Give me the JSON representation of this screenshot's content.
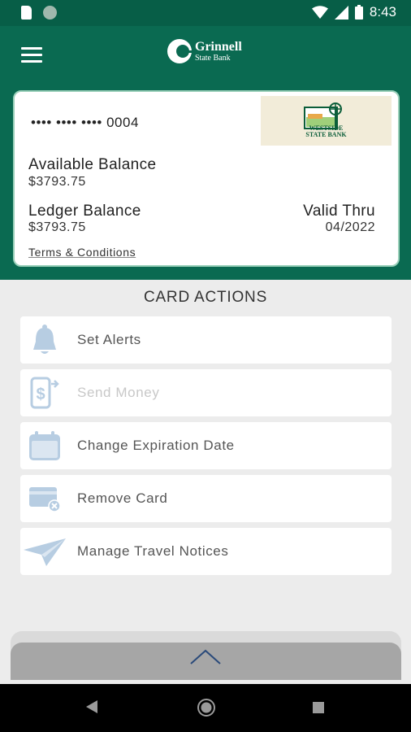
{
  "status_bar": {
    "time": "8:43"
  },
  "app_bar": {
    "logo_name": "Grinnell",
    "logo_sub": "State Bank"
  },
  "card": {
    "number": "•••• •••• •••• 0004",
    "bank_logo_text": "WESTSIDE STATE BANK",
    "available_label": "Available Balance",
    "available_value": "$3793.75",
    "ledger_label": "Ledger Balance",
    "ledger_value": "$3793.75",
    "valid_label": "Valid Thru",
    "valid_value": "04/2022",
    "terms_label": "Terms & Conditions"
  },
  "actions": {
    "title": "CARD ACTIONS",
    "items": [
      {
        "label": "Set Alerts",
        "icon": "bell-icon",
        "enabled": true
      },
      {
        "label": "Send Money",
        "icon": "phone-money-icon",
        "enabled": false
      },
      {
        "label": "Change Expiration Date",
        "icon": "calendar-icon",
        "enabled": true
      },
      {
        "label": "Remove Card",
        "icon": "remove-card-icon",
        "enabled": true
      },
      {
        "label": "Manage Travel Notices",
        "icon": "paper-plane-icon",
        "enabled": true
      }
    ]
  },
  "colors": {
    "brand_green": "#0a6a51",
    "icon_blue": "#b7cde2"
  }
}
